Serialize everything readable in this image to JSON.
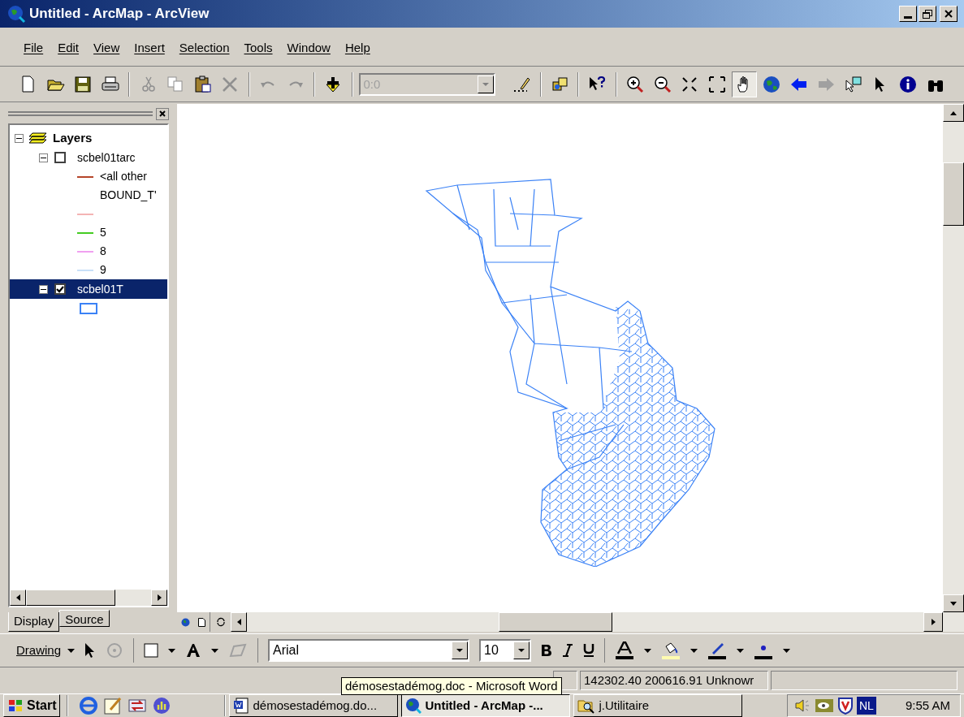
{
  "window": {
    "title": "Untitled - ArcMap - ArcView"
  },
  "menu": [
    "File",
    "Edit",
    "View",
    "Insert",
    "Selection",
    "Tools",
    "Window",
    "Help"
  ],
  "toolbar": {
    "tools": [
      {
        "kind": "new",
        "selected": false
      },
      {
        "kind": "open",
        "selected": false
      },
      {
        "kind": "save",
        "selected": false
      },
      {
        "kind": "print",
        "selected": false
      },
      {
        "kind": "sep"
      },
      {
        "kind": "cut",
        "selected": false
      },
      {
        "kind": "copy",
        "selected": false
      },
      {
        "kind": "paste",
        "selected": false
      },
      {
        "kind": "delete",
        "selected": false
      },
      {
        "kind": "sep"
      },
      {
        "kind": "undo",
        "selected": false
      },
      {
        "kind": "redo",
        "selected": false
      },
      {
        "kind": "sep"
      },
      {
        "kind": "add",
        "selected": false
      }
    ],
    "scale_field": {
      "value": "0:0",
      "disabled": true
    },
    "tools2": [
      {
        "kind": "edit",
        "selected": false
      },
      {
        "kind": "sep"
      },
      {
        "kind": "catalog",
        "selected": false
      },
      {
        "kind": "sep"
      },
      {
        "kind": "help",
        "selected": false
      },
      {
        "kind": "sep"
      },
      {
        "kind": "zoom-in",
        "selected": false
      },
      {
        "kind": "zoom-out",
        "selected": false
      },
      {
        "kind": "fixed-in",
        "selected": false
      },
      {
        "kind": "fixed-out",
        "selected": false
      },
      {
        "kind": "pan",
        "selected": true
      },
      {
        "kind": "globe",
        "selected": false
      },
      {
        "kind": "back",
        "selected": false
      },
      {
        "kind": "forward",
        "selected": false
      },
      {
        "kind": "select-features",
        "selected": false
      },
      {
        "kind": "pointer",
        "selected": false
      },
      {
        "kind": "info",
        "selected": false
      },
      {
        "kind": "find",
        "selected": false
      }
    ]
  },
  "toc": {
    "root": {
      "label": "Layers",
      "expanded": true,
      "children": [
        {
          "label": "scbel01tarc",
          "checked": false,
          "expanded": true,
          "selected": false,
          "legend": [
            {
              "label": "<all other",
              "color": "#b5452a",
              "kind": "line"
            },
            {
              "label": "BOUND_T'",
              "kind": "heading"
            },
            {
              "color": "#f4b4b4",
              "kind": "line"
            },
            {
              "label": "5",
              "color": "#44cc22",
              "kind": "line"
            },
            {
              "label": "8",
              "color": "#f0a0f0",
              "kind": "line"
            },
            {
              "label": "9",
              "color": "#c8e0f8",
              "kind": "line"
            }
          ]
        },
        {
          "label": "scbel01T",
          "checked": true,
          "expanded": true,
          "selected": true,
          "legend": [
            {
              "color": "#3b82f6",
              "kind": "fill"
            }
          ]
        }
      ]
    }
  },
  "tabs": [
    {
      "label": "Display",
      "selected": true
    },
    {
      "label": "Source",
      "selected": false
    }
  ],
  "drawing_toolbar": {
    "menu": "Drawing",
    "font": "Arial",
    "size": "10"
  },
  "status_bar": {
    "coordinates": "142302.40  200616.91 Unknowr"
  },
  "tooltip": "démosestadémog.doc - Microsoft Word",
  "taskbar": {
    "start": "Start",
    "tasks": [
      {
        "label": "démosestadémog.do...",
        "kind": "word",
        "selected": false
      },
      {
        "label": "Untitled - ArcMap -...",
        "kind": "arcmap",
        "selected": true
      },
      {
        "label": "j.Utilitaire",
        "kind": "folder",
        "selected": false
      }
    ],
    "language": "NL",
    "clock": "9:55 AM"
  }
}
